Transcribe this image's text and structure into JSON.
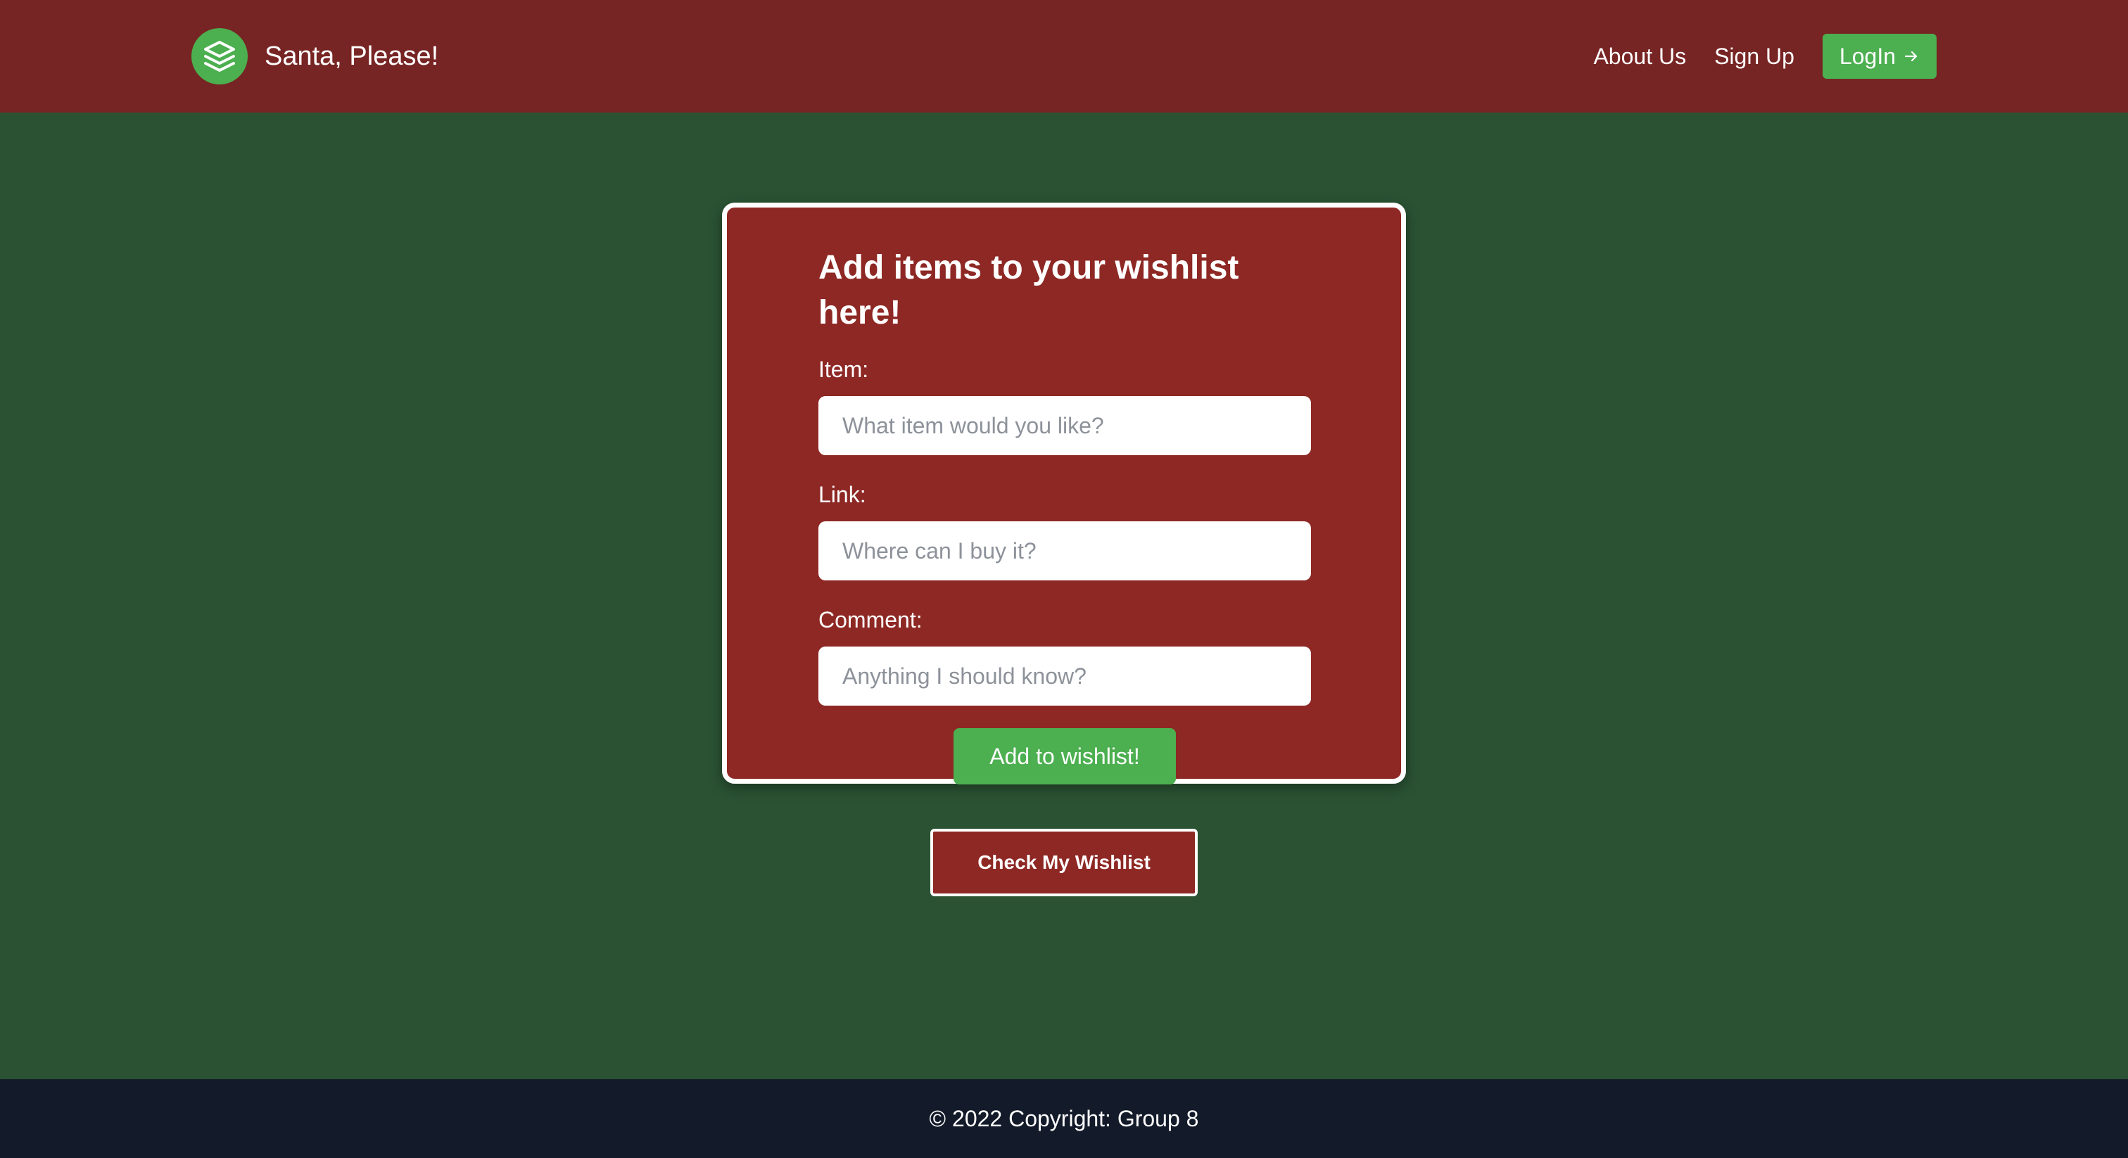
{
  "header": {
    "brand_name": "Santa, Please!",
    "logo_icon": "layers-icon",
    "nav": {
      "about": "About Us",
      "signup": "Sign Up",
      "login": "LogIn",
      "login_icon": "arrow-right-icon"
    }
  },
  "form": {
    "title": "Add items to your wishlist here!",
    "item_label": "Item:",
    "item_placeholder": "What item would you like?",
    "link_label": "Link:",
    "link_placeholder": "Where can I buy it?",
    "comment_label": "Comment:",
    "comment_placeholder": "Anything I should know?",
    "submit_label": "Add to wishlist!"
  },
  "check_wishlist_label": "Check My Wishlist",
  "footer": {
    "copyright": "© 2022 Copyright: Group 8"
  },
  "colors": {
    "header_bg": "#772524",
    "page_bg": "#2a5233",
    "card_bg": "#8e2824",
    "accent_green": "#4caf50",
    "footer_bg": "#131a2a"
  }
}
